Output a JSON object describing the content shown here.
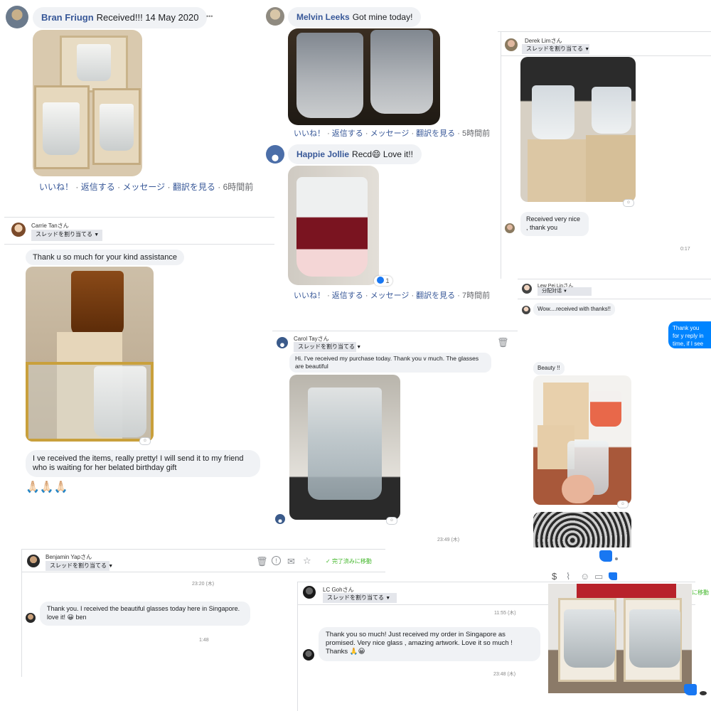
{
  "colors": {
    "fb_blue": "#385898",
    "messenger_blue": "#0084ff",
    "bubble_gray": "#f0f2f5",
    "like_blue": "#1877f2",
    "green_done": "#42b72a"
  },
  "p1": {
    "name": "Bran Friugn",
    "text": "Received!!! 14 May 2020",
    "more": "•••",
    "actions": [
      "いいね！",
      "返信する",
      "メッセージ",
      "翻訳を見る"
    ],
    "sep": "·",
    "time": "6時間前"
  },
  "p2": {
    "name": "Melvin Leeks",
    "text": "Got mine today!",
    "actions": [
      "いいね！",
      "返信する",
      "メッセージ",
      "翻訳を見る"
    ],
    "sep": "·",
    "time": "5時間前"
  },
  "p3": {
    "name": "Happie Jollie",
    "text": "Recd",
    "emoji": "😄",
    "text2": "Love it!!",
    "actions": [
      "いいね！",
      "返信する",
      "メッセージ",
      "翻訳を見る"
    ],
    "sep": "·",
    "time": "7時間前",
    "like_count": "1"
  },
  "p4": {
    "name": "Derek Limさん",
    "dropdown": "スレッドを割り当てる",
    "msg": "Received very nice , thank you",
    "time": "0:17"
  },
  "p5": {
    "name": "Carrie Tanさん",
    "dropdown": "スレッドを割り当てる",
    "msg1": "Thank u so much for your kind assistance",
    "msg2": "I ve received the items, really pretty! I will send it to my friend who is waiting for her belated birthday gift",
    "emojis": "🙏🏻🙏🏻🙏🏻"
  },
  "p6": {
    "name": "Carol Tayさん",
    "dropdown": "スレッドを割り当てる",
    "msg": "Hi. I've received my purchase today. Thank you v much. The glasses are beautiful",
    "time": "23:49 (木)"
  },
  "p7": {
    "name": "Lew Pei Linさん",
    "dropdown": "分配対话",
    "msg1": "Wow....received with thanks!!",
    "blue": "Thank you for y reply in time, if I see the inform",
    "msg2": "Beauty !!"
  },
  "p8": {
    "name": "Benjamin Yapさん",
    "dropdown": "スレッドを割り当てる",
    "done": "完了済みに移動",
    "time1": "23:20 (木)",
    "msg": "Thank you. I received the beautiful glasses today here in Singapore. love it!",
    "emoji": "😀",
    "msg_end": "ben",
    "time2": "1:48"
  },
  "p9": {
    "name": "LC Gohさん",
    "dropdown": "スレッドを割り当てる",
    "time1": "11:55 (木)",
    "msg": "Thank you so much! Just received my order in Singapore as promised. Very nice glass , amazing artwork. Love it so much ! Thanks",
    "emoji": "🙏😀",
    "time2": "23:48 (木)",
    "done_partial": "に移動"
  },
  "icons": {
    "trash": "trash-icon",
    "alert": "alert-icon",
    "mail": "mail-icon",
    "star": "star-icon",
    "check": "check-icon",
    "like": "thumbs-up-icon",
    "dollar": "dollar-icon",
    "clip": "paperclip-icon",
    "smile": "smile-icon",
    "chat": "chat-icon"
  }
}
